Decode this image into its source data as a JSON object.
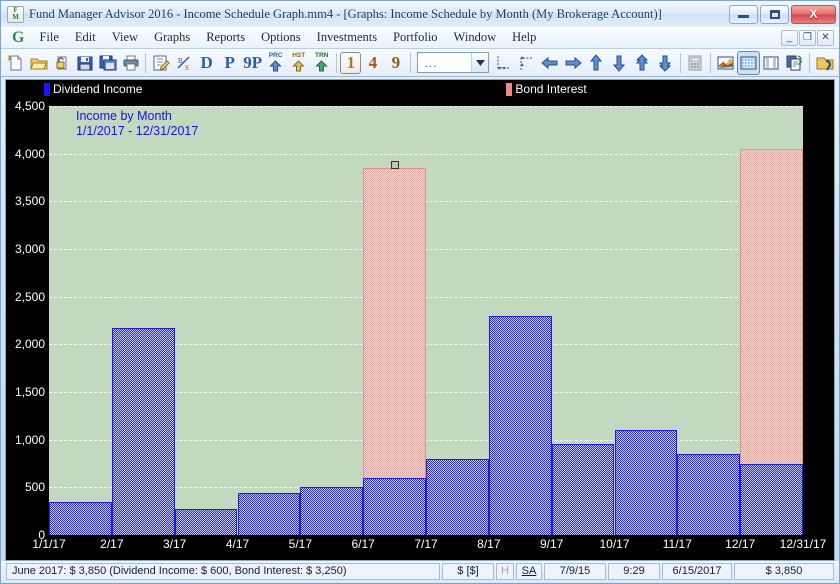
{
  "window": {
    "title": "Fund Manager Advisor 2016 - Income Schedule Graph.mm4 - [Graphs: Income Schedule by Month (My Brokerage Account)]",
    "app_icon_top": "F",
    "app_icon_bottom": "M",
    "minimize_label": "",
    "maximize_label": "",
    "close_label": "X"
  },
  "menubar": {
    "logo": "G",
    "items": [
      {
        "label": "File"
      },
      {
        "label": "Edit"
      },
      {
        "label": "View"
      },
      {
        "label": "Graphs"
      },
      {
        "label": "Reports"
      },
      {
        "label": "Options"
      },
      {
        "label": "Investments"
      },
      {
        "label": "Portfolio"
      },
      {
        "label": "Window"
      },
      {
        "label": "Help"
      }
    ],
    "mdi_minimize": "_",
    "mdi_restore": "❐",
    "mdi_close": "✕"
  },
  "toolbar": {
    "buttons": [
      {
        "name": "new-file-icon",
        "kind": "icon",
        "label": ""
      },
      {
        "name": "open-folder-icon",
        "kind": "icon",
        "label": ""
      },
      {
        "name": "lock-file-icon",
        "kind": "icon",
        "label": ""
      },
      {
        "name": "save-icon",
        "kind": "icon",
        "label": ""
      },
      {
        "name": "save-all-icon",
        "kind": "icon",
        "label": ""
      },
      {
        "name": "print-icon",
        "kind": "icon",
        "label": ""
      }
    ],
    "text_buttons": [
      {
        "name": "edit-note-icon",
        "label": ""
      },
      {
        "name": "percent-split-icon",
        "label": "%"
      },
      {
        "name": "dividend-button",
        "label": "D"
      },
      {
        "name": "price-button",
        "label": "P"
      },
      {
        "name": "nine-p-button",
        "label": "9P"
      }
    ],
    "arrow_buttons": [
      {
        "name": "price-import-button",
        "label": "PRC"
      },
      {
        "name": "history-import-button",
        "label": "HST"
      },
      {
        "name": "transaction-import-button",
        "label": "TRN"
      }
    ],
    "view_numbers": [
      {
        "name": "view-1-button",
        "label": "1",
        "selected": true
      },
      {
        "name": "view-4-button",
        "label": "4",
        "selected": false
      },
      {
        "name": "view-9-button",
        "label": "9",
        "selected": false
      }
    ],
    "combo_value": "...",
    "nav_icons": [
      {
        "name": "zoom-x-axis-icon"
      },
      {
        "name": "zoom-y-axis-icon"
      },
      {
        "name": "arrow-left-icon"
      },
      {
        "name": "arrow-right-icon"
      },
      {
        "name": "arrow-up-icon"
      },
      {
        "name": "arrow-down-icon"
      },
      {
        "name": "arrow-up-page-icon"
      },
      {
        "name": "arrow-down-page-icon"
      },
      {
        "name": "calculator-icon"
      },
      {
        "name": "chart-area-icon"
      },
      {
        "name": "chart-grid-icon"
      },
      {
        "name": "chart-columns-icon"
      },
      {
        "name": "copy-report-icon"
      },
      {
        "name": "help-icon"
      }
    ]
  },
  "legend": [
    {
      "label": "Dividend Income",
      "color": "#1515ff"
    },
    {
      "label": "Bond Interest",
      "color": "#f08a84"
    }
  ],
  "chart_data": {
    "type": "bar",
    "title": "Income by Month",
    "subtitle": "1/1/2017 - 12/31/2017",
    "xlabel": "",
    "ylabel": "",
    "stacked": true,
    "grid": true,
    "plot_background": "#c2d9bf",
    "axis_background": "#000000",
    "ylim": [
      0,
      4500
    ],
    "yticks": [
      0,
      500,
      1000,
      1500,
      2000,
      2500,
      3000,
      3500,
      4000,
      4500
    ],
    "ytick_labels": [
      "0",
      "500",
      "1,000",
      "1,500",
      "2,000",
      "2,500",
      "3,000",
      "3,500",
      "4,000",
      "4,500"
    ],
    "categories": [
      "1/1/17",
      "2/17",
      "3/17",
      "4/17",
      "5/17",
      "6/17",
      "7/17",
      "8/17",
      "9/17",
      "10/17",
      "11/17",
      "12/17",
      "12/31/17"
    ],
    "xtick_labels": [
      "1/1/17",
      "2/17",
      "3/17",
      "4/17",
      "5/17",
      "6/17",
      "7/17",
      "8/17",
      "9/17",
      "10/17",
      "11/17",
      "12/17",
      "12/31/17"
    ],
    "months": [
      "January",
      "February",
      "March",
      "April",
      "May",
      "June",
      "July",
      "August",
      "September",
      "October",
      "November",
      "December"
    ],
    "series": [
      {
        "name": "Dividend Income",
        "color": "#1515ff",
        "values": [
          350,
          2170,
          270,
          440,
          500,
          600,
          800,
          2300,
          950,
          1100,
          850,
          750
        ]
      },
      {
        "name": "Bond Interest",
        "color": "#f08a84",
        "values": [
          0,
          0,
          0,
          0,
          0,
          3250,
          0,
          0,
          0,
          0,
          0,
          3300
        ]
      }
    ],
    "totals": [
      350,
      2170,
      270,
      440,
      500,
      3850,
      800,
      2300,
      950,
      1100,
      850,
      4050
    ],
    "selected_index": 5,
    "legend_position": "top"
  },
  "statusbar": {
    "message": "June 2017: $ 3,850 (Dividend Income: $ 600, Bond Interest: $ 3,250)",
    "currency": "$ [$]",
    "h_flag": "H",
    "sa_flag": "SA",
    "date1": "7/9/15",
    "time": "9:29",
    "date2": "6/15/2017",
    "amount": "$ 3,850"
  }
}
